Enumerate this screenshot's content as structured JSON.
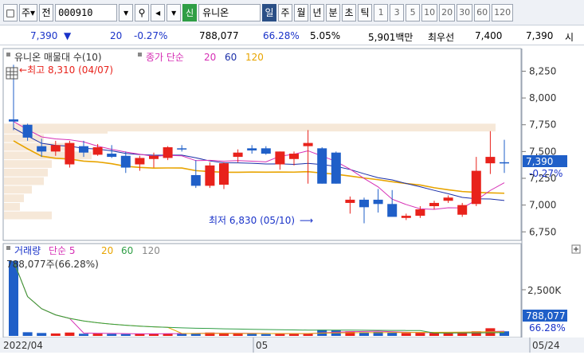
{
  "toolbar": {
    "period_label": "주",
    "prev_label": "전",
    "code": "000910",
    "sin_badge": "신",
    "stock_name": "유니온",
    "periods": [
      "일",
      "주",
      "월",
      "년"
    ],
    "extra": [
      "분",
      "초",
      "틱"
    ],
    "intervals": [
      "1",
      "3",
      "5",
      "10",
      "20",
      "30",
      "60",
      "120"
    ]
  },
  "info": {
    "price": "7,390",
    "change": "20",
    "change_pct": "-0.27%",
    "volume": "788,077",
    "ratio1": "66.28%",
    "ratio2": "5.05%",
    "amount": "5,901백만",
    "bid_label": "최우선",
    "ask": "7,400",
    "bid": "7,390",
    "tail": "시"
  },
  "price_chart": {
    "legend_title": "유니온 매물대 수(10)",
    "legend_ma": "종가 단순",
    "ma_periods": [
      "20",
      "60",
      "120"
    ],
    "high_label": "최고 8,310 (04/07)",
    "low_label": "최저 6,830 (05/10)",
    "y_ticks": [
      "8,250",
      "8,000",
      "7,750",
      "7,500",
      "7,250",
      "7,000",
      "6,750"
    ],
    "current_price": "7,390",
    "current_pct": "-0.27%"
  },
  "volume_chart": {
    "legend_title": "거래량",
    "legend_ma": "단순 5",
    "ma_periods": [
      "20",
      "60",
      "120"
    ],
    "value_label": "788,077주(66.28%)",
    "y_tick": "2,500K",
    "current_volume": "788,077",
    "current_pct": "66.28%"
  },
  "x_axis": {
    "labels": [
      "2022/04",
      "05",
      "05/24"
    ]
  },
  "colors": {
    "up": "#e8221b",
    "down": "#1f5fc8",
    "ma20": "#d62fb5",
    "ma60": "#1a2ea8",
    "ma120": "#e8a400"
  },
  "chart_data": {
    "type": "candlestick",
    "y_range": [
      6700,
      8350
    ],
    "candles": [
      {
        "o": 7800,
        "h": 8310,
        "l": 7700,
        "c": 7780
      },
      {
        "o": 7750,
        "h": 7760,
        "l": 7600,
        "c": 7630
      },
      {
        "o": 7550,
        "h": 7620,
        "l": 7450,
        "c": 7500
      },
      {
        "o": 7500,
        "h": 7600,
        "l": 7460,
        "c": 7560
      },
      {
        "o": 7380,
        "h": 7600,
        "l": 7350,
        "c": 7580
      },
      {
        "o": 7550,
        "h": 7600,
        "l": 7450,
        "c": 7490
      },
      {
        "o": 7470,
        "h": 7570,
        "l": 7460,
        "c": 7540
      },
      {
        "o": 7480,
        "h": 7560,
        "l": 7440,
        "c": 7450
      },
      {
        "o": 7460,
        "h": 7500,
        "l": 7300,
        "c": 7350
      },
      {
        "o": 7380,
        "h": 7460,
        "l": 7320,
        "c": 7440
      },
      {
        "o": 7430,
        "h": 7490,
        "l": 7350,
        "c": 7460
      },
      {
        "o": 7440,
        "h": 7550,
        "l": 7420,
        "c": 7540
      },
      {
        "o": 7530,
        "h": 7560,
        "l": 7500,
        "c": 7520
      },
      {
        "o": 7280,
        "h": 7420,
        "l": 7160,
        "c": 7180
      },
      {
        "o": 7180,
        "h": 7400,
        "l": 7160,
        "c": 7370
      },
      {
        "o": 7190,
        "h": 7400,
        "l": 7150,
        "c": 7390
      },
      {
        "o": 7450,
        "h": 7520,
        "l": 7400,
        "c": 7490
      },
      {
        "o": 7530,
        "h": 7560,
        "l": 7480,
        "c": 7510
      },
      {
        "o": 7530,
        "h": 7550,
        "l": 7470,
        "c": 7480
      },
      {
        "o": 7380,
        "h": 7500,
        "l": 7330,
        "c": 7500
      },
      {
        "o": 7430,
        "h": 7500,
        "l": 7370,
        "c": 7480
      },
      {
        "o": 7550,
        "h": 7700,
        "l": 7200,
        "c": 7580
      },
      {
        "o": 7530,
        "h": 7540,
        "l": 7200,
        "c": 7200
      },
      {
        "o": 7490,
        "h": 7500,
        "l": 7200,
        "c": 7200
      },
      {
        "o": 7020,
        "h": 7080,
        "l": 6920,
        "c": 7050
      },
      {
        "o": 7050,
        "h": 7070,
        "l": 6830,
        "c": 6980
      },
      {
        "o": 7050,
        "h": 7150,
        "l": 6930,
        "c": 7010
      },
      {
        "o": 7010,
        "h": 7140,
        "l": 6920,
        "c": 6890
      },
      {
        "o": 6880,
        "h": 6920,
        "l": 6860,
        "c": 6900
      },
      {
        "o": 6900,
        "h": 6990,
        "l": 6880,
        "c": 6960
      },
      {
        "o": 6990,
        "h": 7040,
        "l": 6960,
        "c": 7020
      },
      {
        "o": 7040,
        "h": 7090,
        "l": 7020,
        "c": 7070
      },
      {
        "o": 6910,
        "h": 7020,
        "l": 6890,
        "c": 7000
      },
      {
        "o": 7010,
        "h": 7450,
        "l": 6990,
        "c": 7320
      },
      {
        "o": 7390,
        "h": 7690,
        "l": 7290,
        "c": 7450
      },
      {
        "o": 7400,
        "h": 7610,
        "l": 7300,
        "c": 7390
      }
    ],
    "volume": [
      2450,
      120,
      95,
      80,
      110,
      70,
      75,
      65,
      60,
      70,
      75,
      80,
      90,
      85,
      110,
      75,
      85,
      70,
      60,
      75,
      70,
      80,
      200,
      180,
      150,
      120,
      130,
      110,
      95,
      100,
      90,
      100,
      120,
      150,
      250,
      150
    ]
  }
}
